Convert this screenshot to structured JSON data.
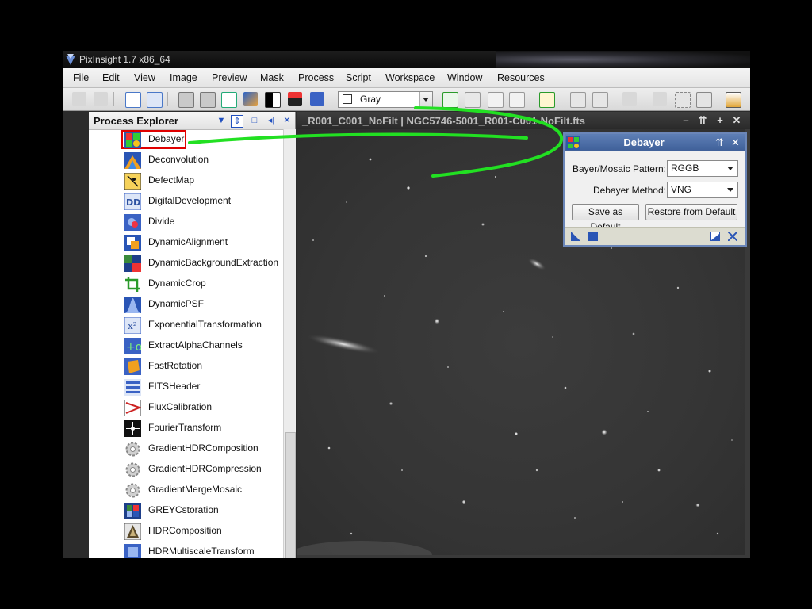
{
  "app": {
    "title": "PixInsight 1.7 x86_64"
  },
  "menu": [
    "File",
    "Edit",
    "View",
    "Image",
    "Preview",
    "Mask",
    "Process",
    "Script",
    "Workspace",
    "Window",
    "Resources"
  ],
  "toolbar": {
    "color_space": "Gray"
  },
  "process_explorer": {
    "title": "Process Explorer",
    "items": [
      {
        "label": "Debayer",
        "icon": "debayer-icon",
        "selected": true
      },
      {
        "label": "Deconvolution",
        "icon": "deconvolution-icon"
      },
      {
        "label": "DefectMap",
        "icon": "defectmap-icon"
      },
      {
        "label": "DigitalDevelopment",
        "icon": "digitaldevelopment-icon"
      },
      {
        "label": "Divide",
        "icon": "divide-icon"
      },
      {
        "label": "DynamicAlignment",
        "icon": "dynamicalignment-icon"
      },
      {
        "label": "DynamicBackgroundExtraction",
        "icon": "dbe-icon"
      },
      {
        "label": "DynamicCrop",
        "icon": "crop-icon"
      },
      {
        "label": "DynamicPSF",
        "icon": "psf-icon"
      },
      {
        "label": "ExponentialTransformation",
        "icon": "exponential-icon"
      },
      {
        "label": "ExtractAlphaChannels",
        "icon": "alpha-icon"
      },
      {
        "label": "FastRotation",
        "icon": "rotation-icon"
      },
      {
        "label": "FITSHeader",
        "icon": "fitsheader-icon"
      },
      {
        "label": "FluxCalibration",
        "icon": "flux-icon"
      },
      {
        "label": "FourierTransform",
        "icon": "fourier-icon"
      },
      {
        "label": "GradientHDRComposition",
        "icon": "gear-icon"
      },
      {
        "label": "GradientHDRCompression",
        "icon": "gear-icon"
      },
      {
        "label": "GradientMergeMosaic",
        "icon": "gear-icon"
      },
      {
        "label": "GREYCstoration",
        "icon": "greycstoration-icon"
      },
      {
        "label": "HDRComposition",
        "icon": "hdr-icon"
      },
      {
        "label": "HDRMultiscaleTransform",
        "icon": "hdrmt-icon"
      }
    ]
  },
  "image_window": {
    "title": "_R001_C001_NoFilt | NGC5746-5001_R001-C001-NoFilt.fts"
  },
  "debayer": {
    "title": "Debayer",
    "pattern_label": "Bayer/Mosaic Pattern:",
    "pattern_value": "RGGB",
    "method_label": "Debayer Method:",
    "method_value": "VNG",
    "save_default": "Save as Default",
    "restore_default": "Restore from Default"
  },
  "colors": {
    "annotation_green": "#22e022",
    "highlight_red": "#e00000",
    "debayer_header": "#4a6aa3"
  }
}
